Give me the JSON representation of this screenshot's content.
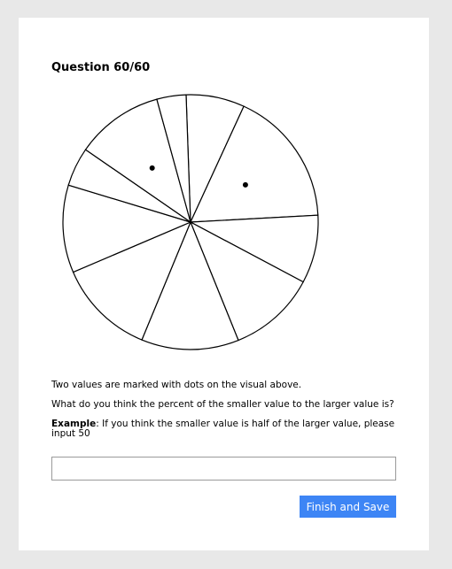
{
  "question": {
    "title": "Question 60/60"
  },
  "chart_data": {
    "type": "pie",
    "values": [
      6,
      14,
      7,
      9,
      10,
      10,
      9,
      4,
      9,
      3
    ],
    "marked_slices": [
      1,
      8
    ],
    "title": "",
    "legend": "none"
  },
  "prompt": {
    "line1": "Two values are marked with dots on the visual above.",
    "line2": "What do you think the percent of the smaller value to the larger value is?",
    "example_label": "Example",
    "example_text": ": If you think the smaller value is half of the larger value, please input 50"
  },
  "answer": {
    "value": "",
    "placeholder": ""
  },
  "actions": {
    "submit_label": "Finish and Save"
  },
  "colors": {
    "page_background": "#e8e8e8",
    "card_background": "#ffffff",
    "accent": "#3d85f5"
  }
}
